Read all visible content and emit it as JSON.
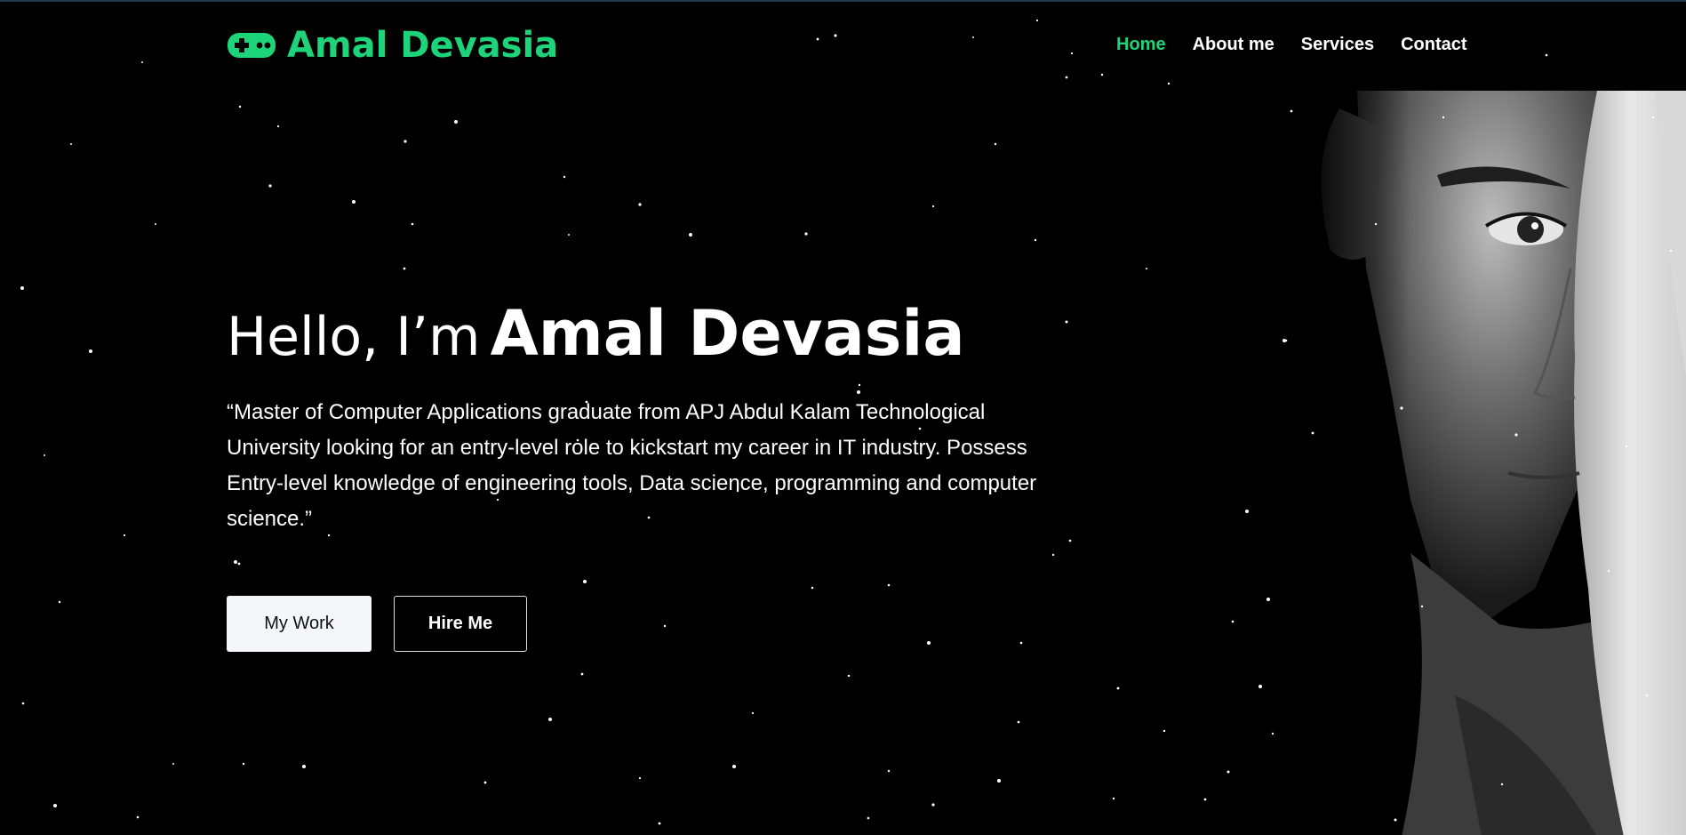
{
  "brand": {
    "name": "Amal Devasia",
    "icon": "gamepad-icon",
    "color": "#1ed47a"
  },
  "nav": {
    "items": [
      {
        "label": "Home",
        "active": true
      },
      {
        "label": "About me",
        "active": false
      },
      {
        "label": "Services",
        "active": false
      },
      {
        "label": "Contact",
        "active": false
      }
    ]
  },
  "hero": {
    "greeting": "Hello, I’m",
    "name": "Amal Devasia",
    "description": "“Master of Computer Applications graduate from APJ Abdul Kalam Technological University looking for an entry-level role to kickstart my career in IT industry. Possess Entry-level knowledge of engineering tools, Data science, programming and computer science.”",
    "buttons": {
      "work": "My Work",
      "hire": "Hire Me"
    }
  },
  "colors": {
    "background": "#000000",
    "accent": "#1ed47a",
    "text": "#ffffff"
  }
}
